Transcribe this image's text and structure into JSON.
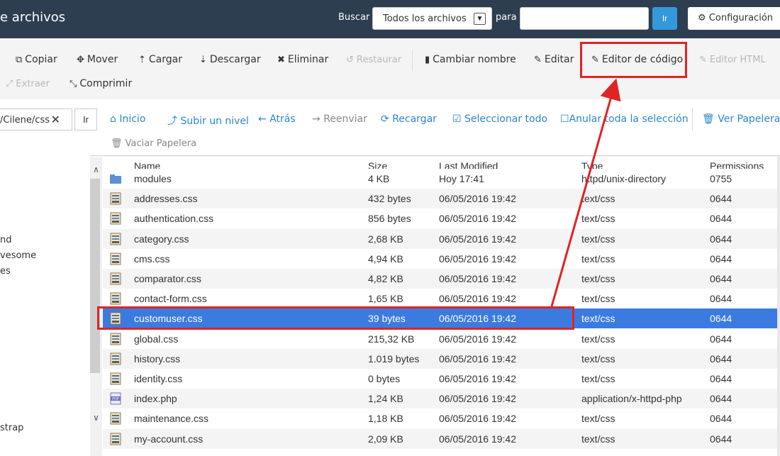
{
  "header": {
    "title": "e archivos",
    "search_label": "Buscar",
    "search_scope": "Todos los archivos",
    "para_label": "para",
    "search_value": "",
    "go_label": "Ir",
    "config_label": "Configuración"
  },
  "toolbar": {
    "copy": "Copiar",
    "move": "Mover",
    "upload": "Cargar",
    "download": "Descargar",
    "delete": "Eliminar",
    "restore": "Restaurar",
    "rename": "Cambiar nombre",
    "edit": "Editar",
    "code_editor": "Editor de código",
    "html_editor": "Editor HTML",
    "extract": "Extraer",
    "compress": "Comprimir"
  },
  "nav": {
    "path_value": "/Cilene/css",
    "go_label": "Ir",
    "home": "Inicio",
    "up_level": "Subir un nivel",
    "back": "Atrás",
    "forward": "Reenviar",
    "reload": "Recargar",
    "select_all": "Seleccionar todo",
    "unselect_all": "Anular toda la selección",
    "view_trash": "Ver Papelera",
    "empty_trash": "Vaciar Papelera"
  },
  "tree": [
    "nd",
    "vesome",
    "es",
    "strap"
  ],
  "table": {
    "columns": [
      "Name",
      "Size",
      "Last Modified",
      "Type",
      "Permissions"
    ],
    "rows": [
      {
        "name": "modules",
        "size": "4 KB",
        "modified": "Hoy 17:41",
        "type": "httpd/unix-directory",
        "perm": "0755",
        "icon": "folder"
      },
      {
        "name": "addresses.css",
        "size": "432 bytes",
        "modified": "06/05/2016 19:42",
        "type": "text/css",
        "perm": "0644",
        "icon": "css"
      },
      {
        "name": "authentication.css",
        "size": "856 bytes",
        "modified": "06/05/2016 19:42",
        "type": "text/css",
        "perm": "0644",
        "icon": "css"
      },
      {
        "name": "category.css",
        "size": "2,68 KB",
        "modified": "06/05/2016 19:42",
        "type": "text/css",
        "perm": "0644",
        "icon": "css"
      },
      {
        "name": "cms.css",
        "size": "4,94 KB",
        "modified": "06/05/2016 19:42",
        "type": "text/css",
        "perm": "0644",
        "icon": "css"
      },
      {
        "name": "comparator.css",
        "size": "4,82 KB",
        "modified": "06/05/2016 19:42",
        "type": "text/css",
        "perm": "0644",
        "icon": "css"
      },
      {
        "name": "contact-form.css",
        "size": "1,65 KB",
        "modified": "06/05/2016 19:42",
        "type": "text/css",
        "perm": "0644",
        "icon": "css"
      },
      {
        "name": "customuser.css",
        "size": "39 bytes",
        "modified": "06/05/2016 19:42",
        "type": "text/css",
        "perm": "0644",
        "icon": "css",
        "selected": true
      },
      {
        "name": "global.css",
        "size": "215,32 KB",
        "modified": "06/05/2016 19:42",
        "type": "text/css",
        "perm": "0644",
        "icon": "css"
      },
      {
        "name": "history.css",
        "size": "1.019 bytes",
        "modified": "06/05/2016 19:42",
        "type": "text/css",
        "perm": "0644",
        "icon": "css"
      },
      {
        "name": "identity.css",
        "size": "0 bytes",
        "modified": "06/05/2016 19:42",
        "type": "text/css",
        "perm": "0644",
        "icon": "css"
      },
      {
        "name": "index.php",
        "size": "1,24 KB",
        "modified": "06/05/2016 19:42",
        "type": "application/x-httpd-php",
        "perm": "0644",
        "icon": "php"
      },
      {
        "name": "maintenance.css",
        "size": "1,18 KB",
        "modified": "06/05/2016 19:42",
        "type": "text/css",
        "perm": "0644",
        "icon": "css"
      },
      {
        "name": "my-account.css",
        "size": "2,09 KB",
        "modified": "06/05/2016 19:42",
        "type": "text/css",
        "perm": "0644",
        "icon": "css"
      }
    ]
  },
  "colors": {
    "header_bg": "#2c3e50",
    "accent": "#3498db",
    "link": "#2a87c8",
    "selection": "#3b7be0",
    "annotation": "#e02424"
  }
}
